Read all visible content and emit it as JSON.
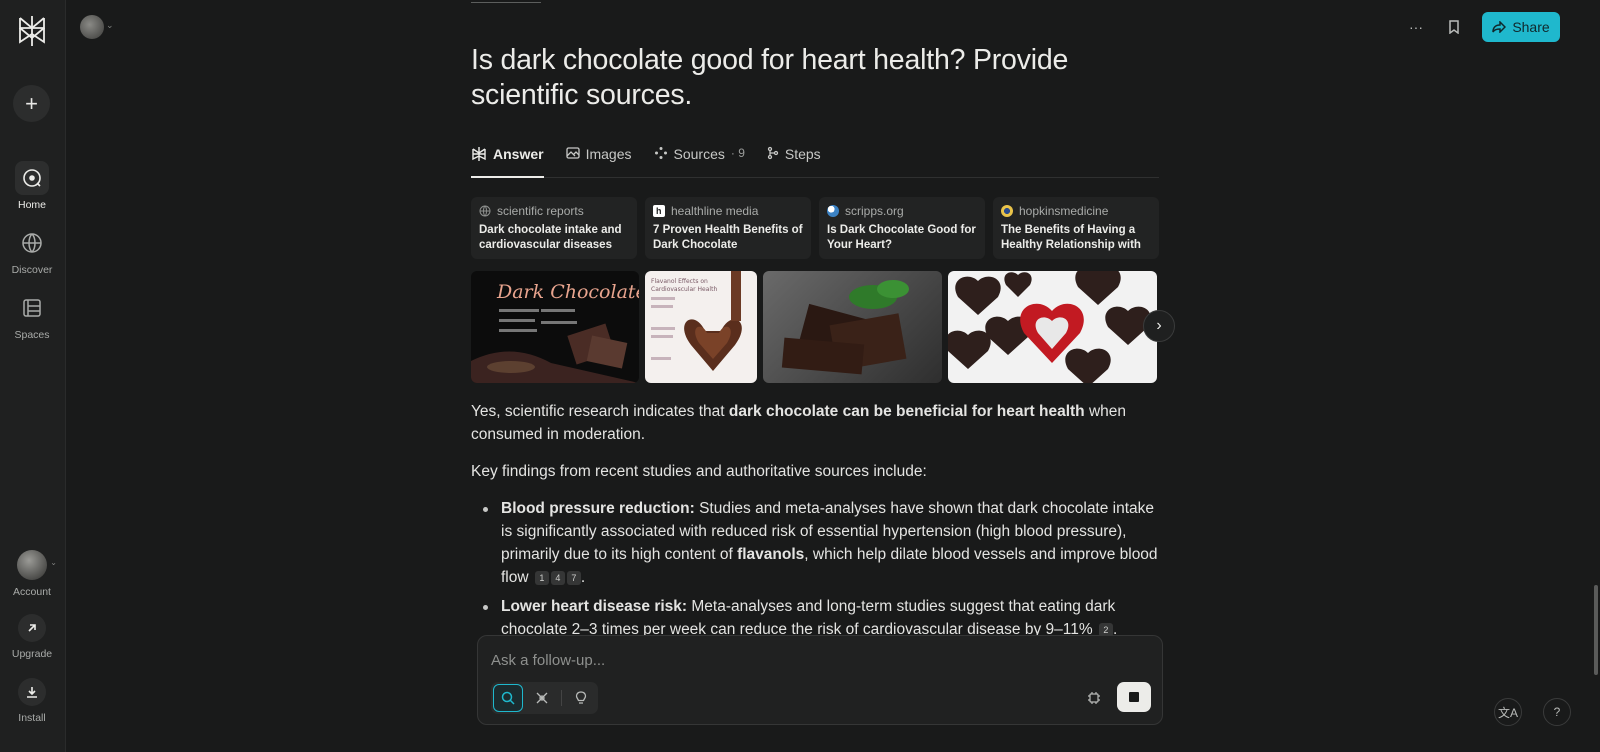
{
  "sidebar": {
    "new_thread_icon": "plus-icon",
    "nav": [
      {
        "label": "Home",
        "icon": "home-icon"
      },
      {
        "label": "Discover",
        "icon": "globe-icon"
      },
      {
        "label": "Spaces",
        "icon": "spaces-icon"
      }
    ],
    "bottom": [
      {
        "label": "Account",
        "icon": "avatar"
      },
      {
        "label": "Upgrade",
        "icon": "arrow-up-right-icon"
      },
      {
        "label": "Install",
        "icon": "download-icon"
      }
    ]
  },
  "header": {
    "share_label": "Share",
    "more_icon": "more-icon",
    "bookmark_icon": "bookmark-icon"
  },
  "query": {
    "title": "Is dark chocolate good for heart health? Provide scientific sources."
  },
  "tabs": [
    {
      "label": "Answer",
      "icon": "answer-icon",
      "active": true
    },
    {
      "label": "Images",
      "icon": "image-icon"
    },
    {
      "label": "Sources",
      "icon": "sources-icon",
      "count": "· 9"
    },
    {
      "label": "Steps",
      "icon": "steps-icon"
    }
  ],
  "sources": [
    {
      "site": "scientific reports",
      "title": "Dark chocolate intake and cardiovascular diseases",
      "favicon_color": "#6a6c6a"
    },
    {
      "site": "healthline media",
      "title": "7 Proven Health Benefits of Dark Chocolate",
      "favicon_color": "#ffffff"
    },
    {
      "site": "scripps.org",
      "title": "Is Dark Chocolate Good for Your Heart?",
      "favicon_color": "#3b82c4"
    },
    {
      "site": "hopkinsmedicine",
      "title": "The Benefits of Having a Healthy Relationship with ...",
      "favicon_color": "#e9c34a"
    }
  ],
  "images": [
    {
      "alt": "Dark Chocolate",
      "caption": "Dark Chocolate"
    },
    {
      "alt": "Flavanol Effects on Cardiovascular Health",
      "caption": "Flavanol Effects on Cardiovascular Health"
    },
    {
      "alt": "Dark chocolate pieces with mint"
    },
    {
      "alt": "Chocolate hearts with red foil heart"
    }
  ],
  "answer": {
    "intro_pre": "Yes, scientific research indicates that ",
    "intro_bold": "dark chocolate can be beneficial for heart health",
    "intro_post": " when consumed in moderation.",
    "key_findings": "Key findings from recent studies and authoritative sources include:",
    "bullets": [
      {
        "heading": "Blood pressure reduction:",
        "text_pre": " Studies and meta-analyses have shown that dark chocolate intake is significantly associated with reduced risk of essential hypertension (high blood pressure), primarily due to its high content of ",
        "bold": "flavanols",
        "text_post": ", which help dilate blood vessels and improve blood flow",
        "cites": [
          "1",
          "4",
          "7"
        ]
      },
      {
        "heading": "Lower heart disease risk:",
        "text_pre": " Meta-analyses and long-term studies suggest that eating dark chocolate 2–3 times per week can reduce the risk of cardiovascular disease by 9–11%",
        "cites": [
          "2"
        ]
      }
    ]
  },
  "followup": {
    "placeholder": "Ask a follow-up...",
    "modes": [
      "search-icon",
      "research-icon",
      "lightbulb-icon"
    ],
    "model_icon": "chip-icon",
    "stop_icon": "stop-icon"
  },
  "corner": {
    "translate_label": "文A",
    "help_label": "?"
  },
  "colors": {
    "accent": "#1fb8cd",
    "background": "#191a1a",
    "sidebar": "#1f2020"
  }
}
